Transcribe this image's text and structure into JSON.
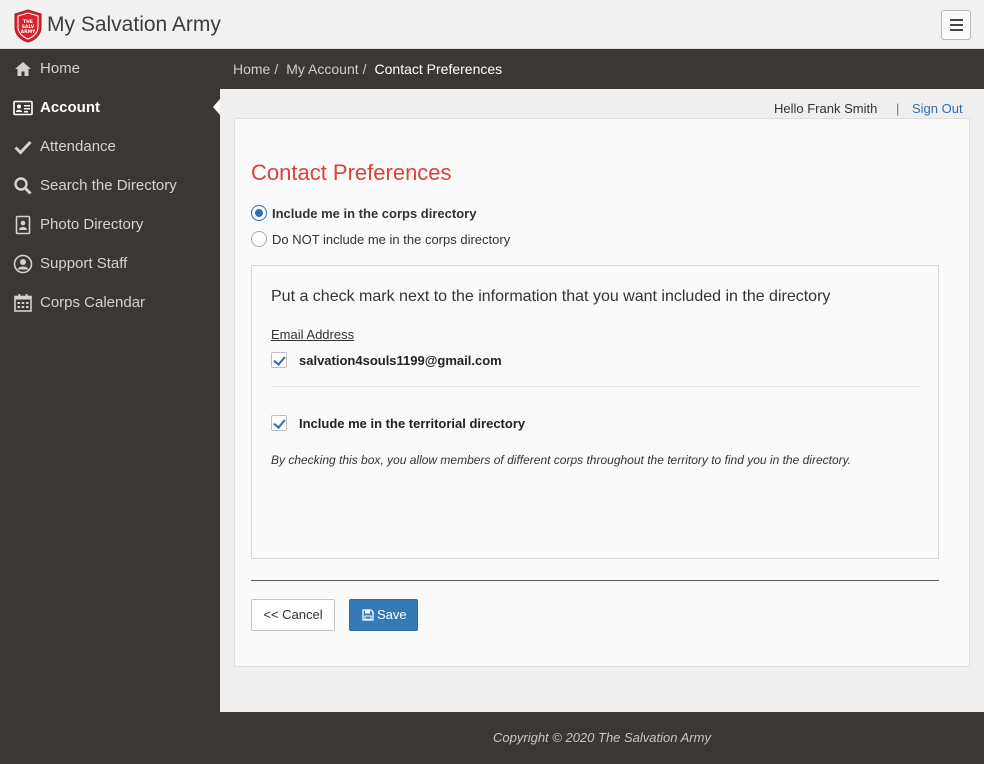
{
  "header": {
    "app_title": "My Salvation Army",
    "logo_text": "THE SALVATION ARMY",
    "brand_color": "#d9232d"
  },
  "sidebar": {
    "items": [
      {
        "label": "Home",
        "icon": "home-icon"
      },
      {
        "label": "Account",
        "icon": "id-card-icon",
        "active": true
      },
      {
        "label": "Attendance",
        "icon": "check-icon"
      },
      {
        "label": "Search the Directory",
        "icon": "search-icon"
      },
      {
        "label": "Photo Directory",
        "icon": "photo-book-icon"
      },
      {
        "label": "Support Staff",
        "icon": "user-circle-icon"
      },
      {
        "label": "Corps Calendar",
        "icon": "calendar-icon"
      }
    ]
  },
  "breadcrumb": {
    "home": "Home",
    "account": "My Account",
    "current": "Contact Preferences",
    "separator": "/"
  },
  "userbar": {
    "greeting": "Hello Frank Smith",
    "divider": "|",
    "sign_out": "Sign Out"
  },
  "main": {
    "title": "Contact Preferences",
    "radio_include": "Include me in the corps directory",
    "radio_exclude": "Do NOT include me in the corps directory",
    "instructions": "Put a check mark next to the information that you want included in the directory",
    "email_heading": "Email Address",
    "email_value": "salvation4souls1199@gmail.com",
    "territorial_label": "Include me in the territorial directory",
    "territorial_note": "By checking this box, you allow members of different corps throughout the territory to find you in the directory.",
    "cancel_label": "<< Cancel",
    "save_label": "Save"
  },
  "footer": {
    "copyright": "Copyright © 2020 The Salvation Army"
  }
}
